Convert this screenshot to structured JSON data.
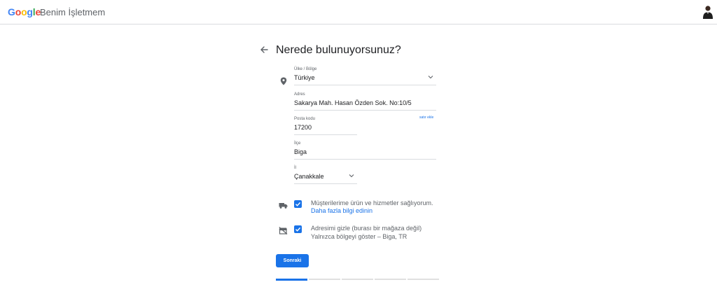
{
  "header": {
    "logo_letters": [
      "G",
      "o",
      "o",
      "g",
      "l",
      "e"
    ],
    "product": "Benim İşletmem",
    "colors": {
      "blue": "#4285f4",
      "red": "#ea4335",
      "yellow": "#fbbc05",
      "green": "#34a853"
    }
  },
  "page": {
    "title": "Nerede bulunuyorsunuz?"
  },
  "form": {
    "country": {
      "label": "Ülke / Bölge",
      "value": "Türkiye"
    },
    "address": {
      "label": "Adres",
      "value": "Sakarya Mah. Hasan Özden Sok. No:10/5"
    },
    "add_line": "satır ekle",
    "postal": {
      "label": "Posta kodu",
      "value": "17200"
    },
    "district": {
      "label": "İlçe",
      "value": "Biga"
    },
    "province": {
      "label": "İl",
      "value": "Çanakkale"
    }
  },
  "options": {
    "delivery": {
      "checked": true,
      "text": "Müşterilerime ürün ve hizmetler sağlıyorum.",
      "link": "Daha fazla bilgi edinin"
    },
    "hide_address": {
      "checked": true,
      "text": "Adresimi gizle (burası bir mağaza değil)",
      "sub": "Yalnızca bölgeyi göster – Biga, TR"
    }
  },
  "actions": {
    "next_label": "Sonraki"
  },
  "progress": {
    "total_steps": 5,
    "current_step": 1
  },
  "accent": "#1a73e8"
}
